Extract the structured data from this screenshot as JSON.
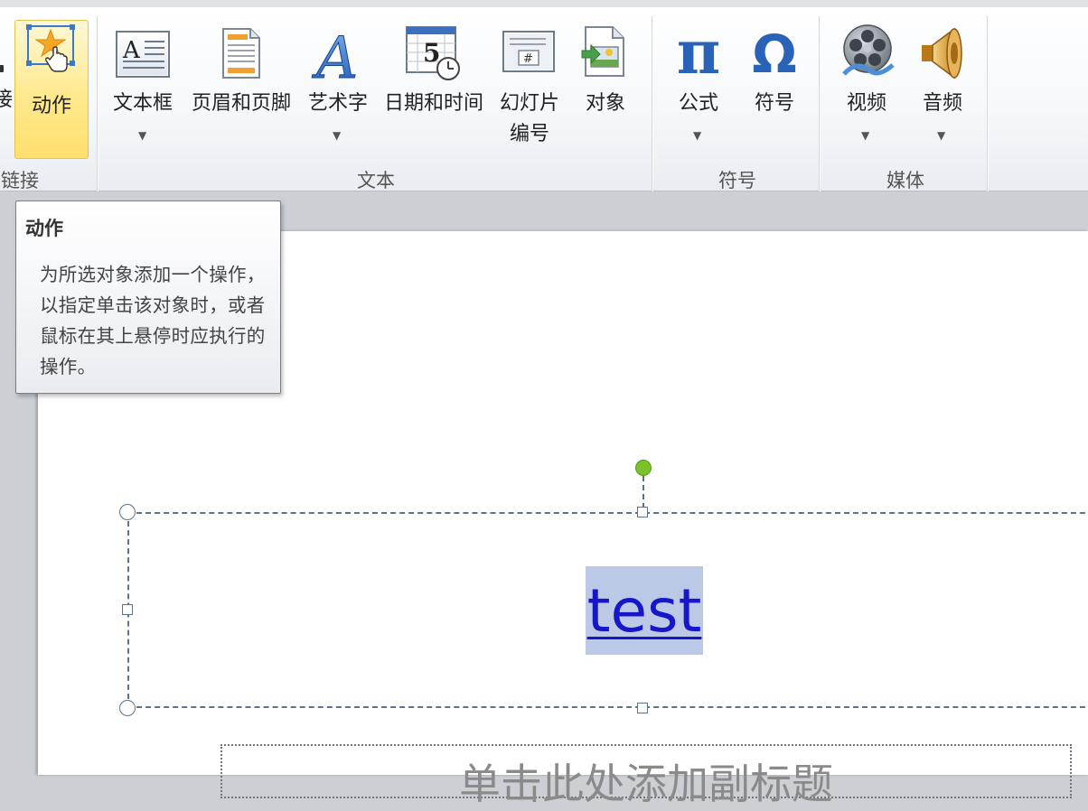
{
  "ribbon": {
    "groups": [
      {
        "id": "links",
        "label": "链接",
        "buttons": [
          {
            "id": "action",
            "label": "动作"
          }
        ],
        "partial_left_label": "接"
      },
      {
        "id": "text",
        "label": "文本",
        "buttons": [
          {
            "id": "textbox",
            "label": "文本框"
          },
          {
            "id": "header_footer",
            "label": "页眉和页脚"
          },
          {
            "id": "wordart",
            "label": "艺术字"
          },
          {
            "id": "datetime",
            "label": "日期和时间"
          },
          {
            "id": "slide_number",
            "label_line1": "幻灯片",
            "label_line2": "编号"
          },
          {
            "id": "object",
            "label": "对象"
          }
        ]
      },
      {
        "id": "symbols",
        "label": "符号",
        "buttons": [
          {
            "id": "equation",
            "label": "公式"
          },
          {
            "id": "symbol",
            "label": "符号"
          }
        ]
      },
      {
        "id": "media",
        "label": "媒体",
        "buttons": [
          {
            "id": "video",
            "label": "视频"
          },
          {
            "id": "audio",
            "label": "音频"
          }
        ]
      }
    ],
    "links_label_visible": "链接",
    "text_group_label": "文本",
    "symbols_group_label": "符号",
    "media_group_label": "媒体",
    "action_label": "动作",
    "textbox_label": "文本框",
    "header_footer_label": "页眉和页脚",
    "wordart_label": "艺术字",
    "datetime_label": "日期和时间",
    "slide_number_line1": "幻灯片",
    "slide_number_line2": "编号",
    "object_label": "对象",
    "equation_label": "公式",
    "symbol_label": "符号",
    "video_label": "视频",
    "audio_label": "音频",
    "partial_left_label": "接",
    "icon_glyphs": {
      "equation": "π",
      "symbol": "Ω",
      "textbox": "A",
      "wordart": "A",
      "datetime": "5",
      "slide_number": "#"
    }
  },
  "tooltip": {
    "title": "动作",
    "body": "为所选对象添加一个操作，以指定单击该对象时，或者鼠标在其上悬停时应执行的操作。"
  },
  "slide": {
    "title_text": "test",
    "subtitle_placeholder": "单击此处添加副标题"
  },
  "colors": {
    "hover_button": "#ffe98e",
    "title_link": "#1717c9",
    "selection_highlight": "#bcc9e6",
    "rotation_handle": "#79c22c"
  }
}
